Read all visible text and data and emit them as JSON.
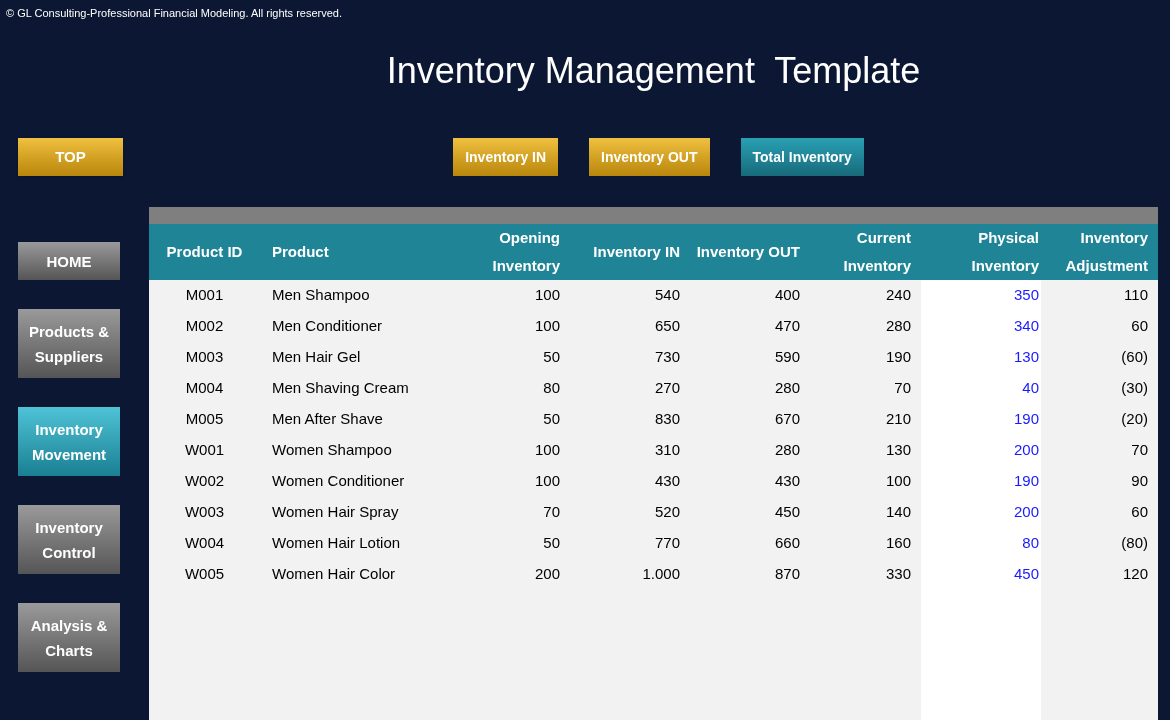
{
  "copyright": "© GL Consulting-Professional Financial Modeling. All rights reserved.",
  "title": "Inventory Management  Template",
  "top_button": "TOP",
  "sidebar": {
    "items": [
      {
        "label": "HOME",
        "selected": false
      },
      {
        "label": "Products & Suppliers",
        "selected": false
      },
      {
        "label": "Inventory Movement",
        "selected": true
      },
      {
        "label": "Inventory Control",
        "selected": false
      },
      {
        "label": "Analysis & Charts",
        "selected": false
      }
    ]
  },
  "tabs": [
    {
      "label": "Inventory IN",
      "selected": false
    },
    {
      "label": "Inventory OUT",
      "selected": false
    },
    {
      "label": "Total Inventory",
      "selected": true
    }
  ],
  "table": {
    "columns": [
      {
        "label": "Product ID",
        "kind": "id"
      },
      {
        "label": "Product",
        "kind": "text"
      },
      {
        "label": "Opening Inventory",
        "kind": "number"
      },
      {
        "label": "Inventory IN",
        "kind": "number"
      },
      {
        "label": "Inventory OUT",
        "kind": "number"
      },
      {
        "label": "Current Inventory",
        "kind": "number"
      },
      {
        "label": "Physical Inventory",
        "kind": "input"
      },
      {
        "label": "Inventory Adjustment",
        "kind": "number"
      }
    ],
    "rows": [
      [
        "M001",
        "Men Shampoo",
        "100",
        "540",
        "400",
        "240",
        "350",
        "110"
      ],
      [
        "M002",
        "Men Conditioner",
        "100",
        "650",
        "470",
        "280",
        "340",
        "60"
      ],
      [
        "M003",
        "Men Hair Gel",
        "50",
        "730",
        "590",
        "190",
        "130",
        "(60)"
      ],
      [
        "M004",
        "Men Shaving Cream",
        "80",
        "270",
        "280",
        "70",
        "40",
        "(30)"
      ],
      [
        "M005",
        "Men After Shave",
        "50",
        "830",
        "670",
        "210",
        "190",
        "(20)"
      ],
      [
        "W001",
        "Women Shampoo",
        "100",
        "310",
        "280",
        "130",
        "200",
        "70"
      ],
      [
        "W002",
        "Women Conditioner",
        "100",
        "430",
        "430",
        "100",
        "190",
        "90"
      ],
      [
        "W003",
        "Women Hair Spray",
        "70",
        "520",
        "450",
        "140",
        "200",
        "60"
      ],
      [
        "W004",
        "Women Hair Lotion",
        "50",
        "770",
        "660",
        "160",
        "80",
        "(80)"
      ],
      [
        "W005",
        "Women Hair Color",
        "200",
        "1.000",
        "870",
        "330",
        "450",
        "120"
      ]
    ]
  }
}
